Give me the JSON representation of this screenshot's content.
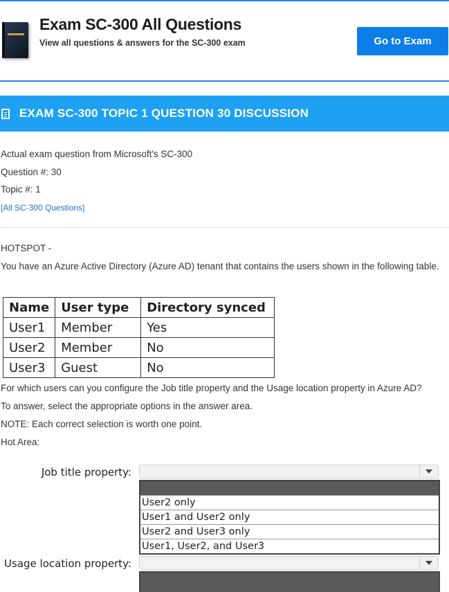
{
  "header": {
    "title": "Exam SC-300 All Questions",
    "subtitle": "View all questions & answers for the SC-300 exam",
    "button_label": "Go to Exam"
  },
  "banner": {
    "title": "EXAM SC-300 TOPIC 1 QUESTION 30 DISCUSSION"
  },
  "meta": {
    "line1": "Actual exam question from Microsoft's SC-300",
    "question": "Question #: 30",
    "topic": "Topic #: 1",
    "link": "[All SC-300 Questions]"
  },
  "question": {
    "type": "HOTSPOT -",
    "intro": "You have an Azure Active Directory (Azure AD) tenant that contains the users shown in the following table.",
    "table": {
      "headers": [
        "Name",
        "User type",
        "Directory synced"
      ],
      "rows": [
        [
          "User1",
          "Member",
          "Yes"
        ],
        [
          "User2",
          "Member",
          "No"
        ],
        [
          "User3",
          "Guest",
          "No"
        ]
      ]
    },
    "prompt": "For which users can you configure the Job title property and the Usage location property in Azure AD?",
    "instruction": "To answer, select the appropriate options in the answer area.",
    "note": "NOTE: Each correct selection is worth one point.",
    "hot_area": "Hot Area:"
  },
  "hotspot": {
    "job_title_label": "Job title property:",
    "usage_location_label": "Usage location property:",
    "options": [
      "User2 only",
      "User1 and User2 only",
      "User2 and User3 only",
      "User1, User2, and User3"
    ]
  }
}
